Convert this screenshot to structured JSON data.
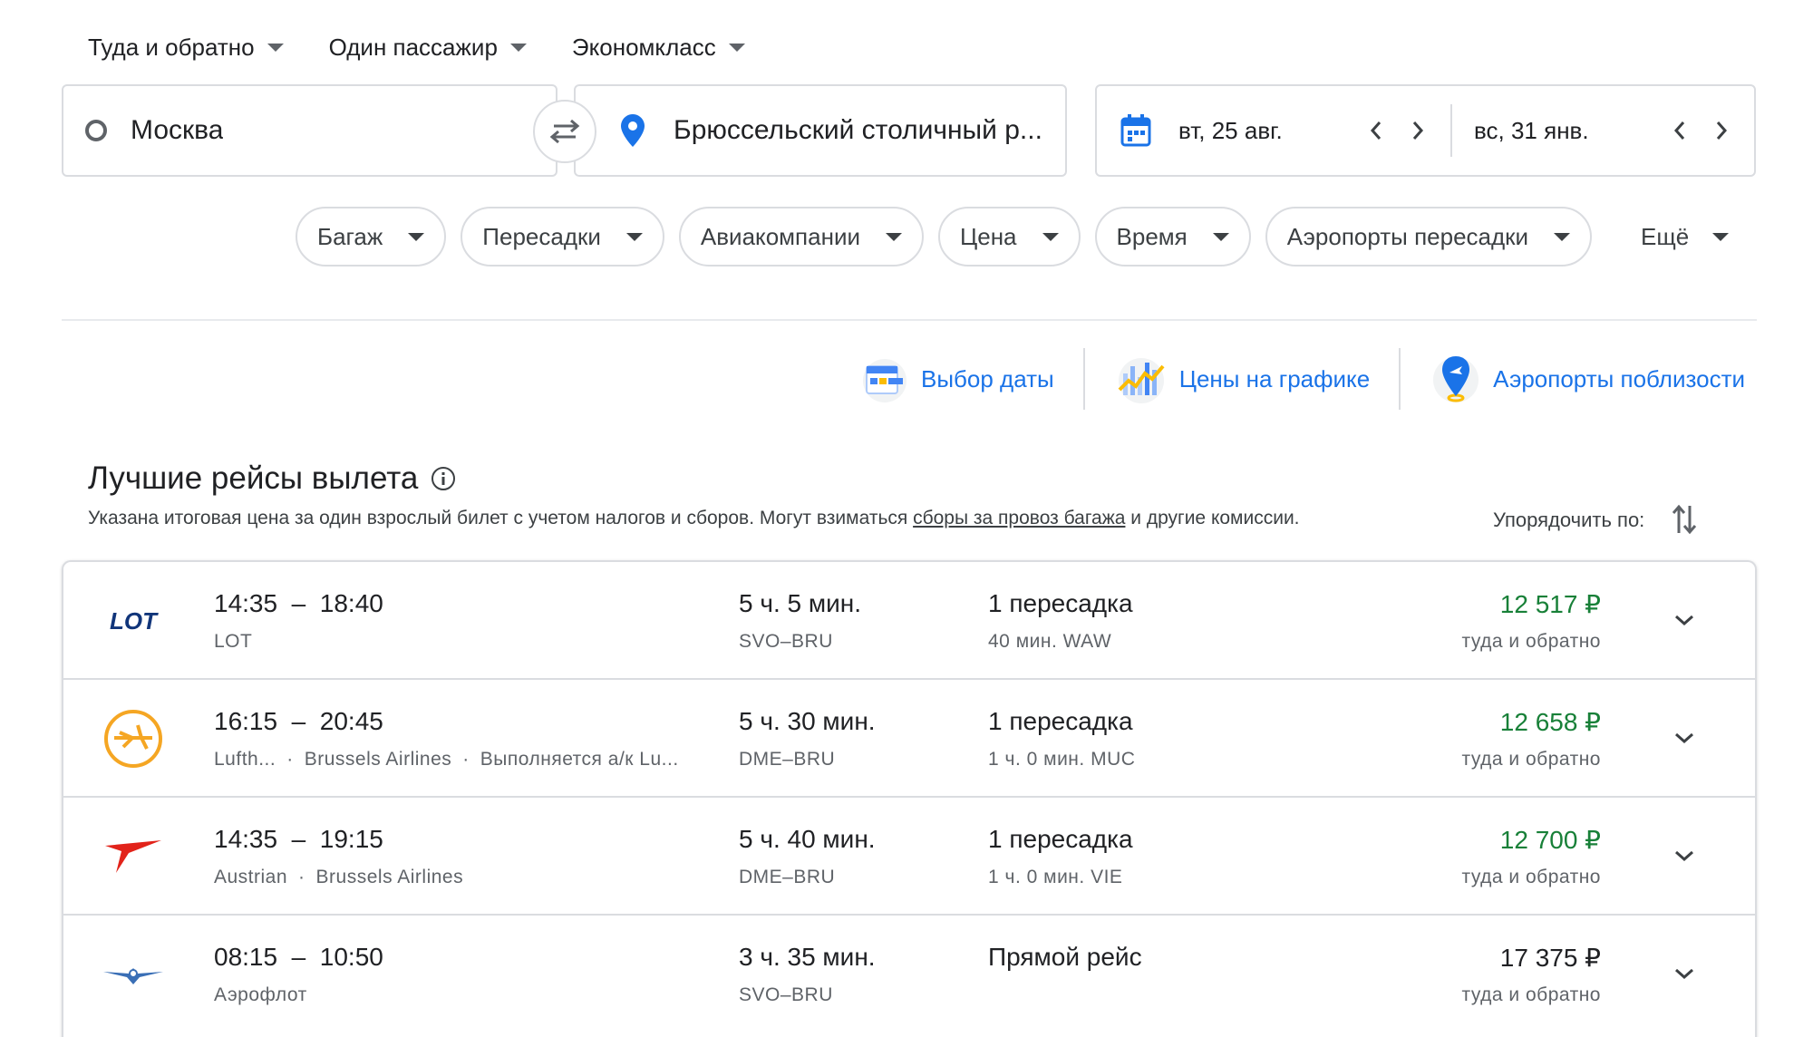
{
  "trip_options": {
    "trip_type": "Туда и обратно",
    "passengers": "Один пассажир",
    "cabin_class": "Экономкласс"
  },
  "search": {
    "origin": "Москва",
    "destination": "Брюссельский столичный р...",
    "depart_date": "вт, 25 авг.",
    "return_date": "вс, 31 янв."
  },
  "filters": [
    "Багаж",
    "Пересадки",
    "Авиакомпании",
    "Цена",
    "Время",
    "Аэропорты пересадки"
  ],
  "filters_more": "Ещё",
  "explore": {
    "date_grid": "Выбор даты",
    "price_graph": "Цены на графике",
    "nearby_airports": "Аэропорты поблизости"
  },
  "results": {
    "title": "Лучшие рейсы вылета",
    "note_before": "Указана итоговая цена за один взрослый билет с учетом налогов и сборов. Могут взиматься ",
    "note_link": "сборы за провоз багажа",
    "note_after": " и другие комиссии.",
    "sort_label": "Упорядочить по:"
  },
  "flights": [
    {
      "logo": "lot-logo",
      "depart": "14:35",
      "arrive": "18:40",
      "airlines": [
        "LOT"
      ],
      "duration": "5 ч. 5 мин.",
      "route": "SVO–BRU",
      "stops": "1 пересадка",
      "layover": "40 мин. WAW",
      "price": "12 517 ₽",
      "price_note": "туда и обратно",
      "price_color": "#188038"
    },
    {
      "logo": "lufthansa-logo",
      "depart": "16:15",
      "arrive": "20:45",
      "airlines": [
        "Lufth...",
        "Brussels Airlines",
        "Выполняется а/к Lu..."
      ],
      "duration": "5 ч. 30 мин.",
      "route": "DME–BRU",
      "stops": "1 пересадка",
      "layover": "1 ч. 0 мин. MUC",
      "price": "12 658 ₽",
      "price_note": "туда и обратно",
      "price_color": "#188038"
    },
    {
      "logo": "austrian-logo",
      "depart": "14:35",
      "arrive": "19:15",
      "airlines": [
        "Austrian",
        "Brussels Airlines"
      ],
      "duration": "5 ч. 40 мин.",
      "route": "DME–BRU",
      "stops": "1 пересадка",
      "layover": "1 ч. 0 мин. VIE",
      "price": "12 700 ₽",
      "price_note": "туда и обратно",
      "price_color": "#188038"
    },
    {
      "logo": "aeroflot-logo",
      "depart": "08:15",
      "arrive": "10:50",
      "airlines": [
        "Аэрофлот"
      ],
      "duration": "3 ч. 35 мин.",
      "route": "SVO–BRU",
      "stops": "Прямой рейс",
      "layover": "",
      "price": "17 375 ₽",
      "price_note": "туда и обратно",
      "price_color": "#202124"
    }
  ],
  "colors": {
    "accent": "#1a73e8",
    "good_price": "#188038",
    "border": "#dadce0"
  }
}
